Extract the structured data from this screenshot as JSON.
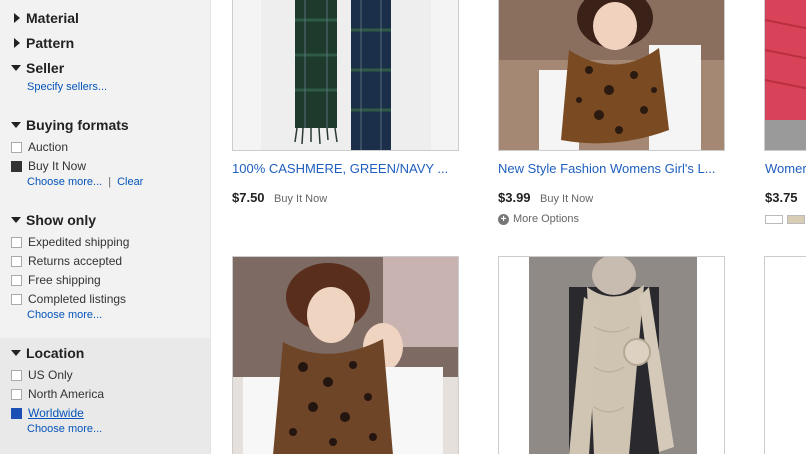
{
  "sidebar": {
    "material": "Material",
    "pattern": "Pattern",
    "seller": {
      "title": "Seller",
      "link": "Specify sellers..."
    },
    "buying_formats": {
      "title": "Buying formats",
      "options": [
        "Auction",
        "Buy It Now"
      ],
      "choose_more": "Choose more...",
      "sep": "|",
      "clear": "Clear"
    },
    "show_only": {
      "title": "Show only",
      "options": [
        "Expedited shipping",
        "Returns accepted",
        "Free shipping",
        "Completed listings"
      ],
      "choose_more": "Choose more..."
    },
    "location": {
      "title": "Location",
      "options": [
        "US Only",
        "North America",
        "Worldwide"
      ],
      "choose_more": "Choose more..."
    }
  },
  "products": [
    {
      "title": "100% CASHMERE, GREEN/NAVY ...",
      "price": "$7.50",
      "format": "Buy It Now"
    },
    {
      "title": "New Style Fashion Womens Girl's L...",
      "price": "$3.99",
      "format": "Buy It Now",
      "more_options": "More Options"
    },
    {
      "title": "Womer",
      "price": "$3.75"
    },
    {
      "title": ""
    },
    {
      "title": ""
    }
  ],
  "colors": {
    "link": "#0654ba",
    "title": "#1f5fbf",
    "sidebar_bg": "#f2f2f2"
  },
  "icons": {
    "expand": "triangle-right-icon",
    "collapse": "triangle-down-icon",
    "more": "plus-circle-icon"
  }
}
